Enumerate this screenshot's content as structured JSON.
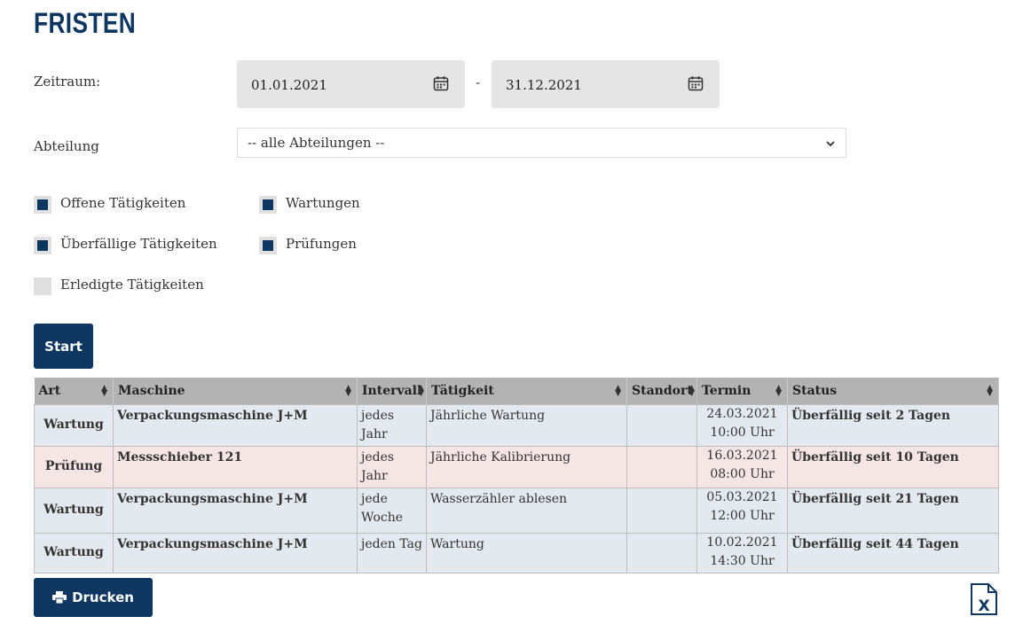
{
  "title": "FRISTEN",
  "filter": {
    "zeitraum_label": "Zeitraum:",
    "date_from": "01.01.2021",
    "date_separator": "-",
    "date_to": "31.12.2021",
    "abteilung_label": "Abteilung",
    "abteilung_selected": "-- alle Abteilungen --"
  },
  "checkboxes": [
    {
      "label": "Offene Tätigkeiten",
      "checked": true
    },
    {
      "label": "Wartungen",
      "checked": true
    },
    {
      "label": "Überfällige Tätigkeiten",
      "checked": true
    },
    {
      "label": "Prüfungen",
      "checked": true
    },
    {
      "label": "Erledigte Tätigkeiten",
      "checked": false
    }
  ],
  "buttons": {
    "start": "Start",
    "print": "Drucken"
  },
  "table": {
    "headers": [
      "Art",
      "Maschine",
      "Intervall",
      "Tätigkeit",
      "Standort",
      "Termin",
      "Status"
    ],
    "rows": [
      {
        "art": "Wartung",
        "maschine": "Verpackungsmaschine J+M",
        "intervall": "jedes Jahr",
        "taetigkeit": "Jährliche Wartung",
        "standort": "",
        "termin_datum": "24.03.2021",
        "termin_zeit": "10:00 Uhr",
        "status": "Überfällig seit 2 Tagen"
      },
      {
        "art": "Prüfung",
        "maschine": "Messschieber 121",
        "intervall": "jedes Jahr",
        "taetigkeit": "Jährliche Kalibrierung",
        "standort": "",
        "termin_datum": "16.03.2021",
        "termin_zeit": "08:00 Uhr",
        "status": "Überfällig seit 10 Tagen"
      },
      {
        "art": "Wartung",
        "maschine": "Verpackungsmaschine J+M",
        "intervall": "jede Woche",
        "taetigkeit": "Wasserzähler ablesen",
        "standort": "",
        "termin_datum": "05.03.2021",
        "termin_zeit": "12:00 Uhr",
        "status": "Überfällig seit 21 Tagen"
      },
      {
        "art": "Wartung",
        "maschine": "Verpackungsmaschine J+M",
        "intervall": "jeden Tag",
        "taetigkeit": "Wartung",
        "standort": "",
        "termin_datum": "10.02.2021",
        "termin_zeit": "14:30 Uhr",
        "status": "Überfällig seit 44 Tagen"
      }
    ]
  },
  "colors": {
    "primary": "#0d3660",
    "status_overdue": "#e00000",
    "row_wartung": "#e4e8ef",
    "row_pruefung": "#f5e5e5",
    "header_bg": "#b3b3b3"
  },
  "icons": {
    "calendar": "calendar-icon",
    "chevron": "chevron-down-icon",
    "sort": "sort-icon",
    "print": "printer-icon",
    "excel": "excel-export-icon"
  }
}
